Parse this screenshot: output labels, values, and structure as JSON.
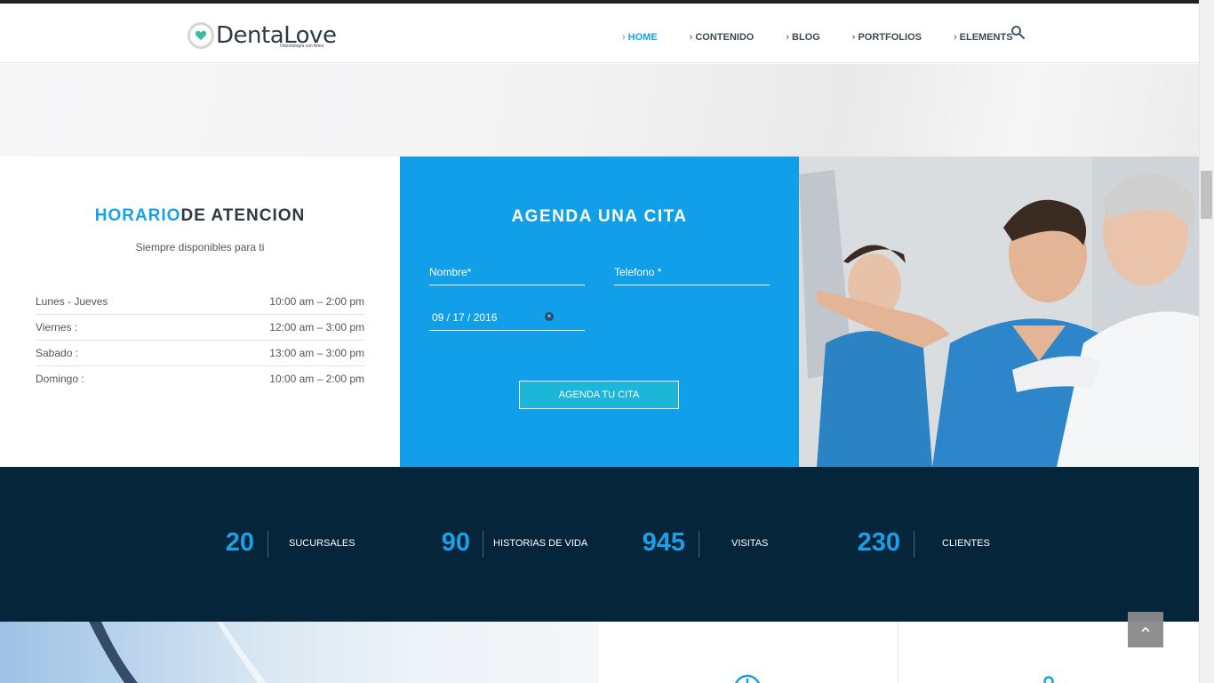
{
  "brand": {
    "name": "DentaLove",
    "tagline": "Odontología con Amor"
  },
  "nav": {
    "items": [
      {
        "label": "HOME",
        "active": true
      },
      {
        "label": "CONTENIDO",
        "active": false
      },
      {
        "label": "BLOG",
        "active": false
      },
      {
        "label": "PORTFOLIOS",
        "active": false
      },
      {
        "label": "ELEMENTS",
        "active": false
      }
    ],
    "search_icon": "search-icon"
  },
  "schedule": {
    "title_highlight": "HORARIO",
    "title_rest": "DE ATENCION",
    "subtitle": "Siempre disponibles para ti",
    "rows": [
      {
        "day": "Lunes - Jueves",
        "hours": "10:00 am – 2:00 pm"
      },
      {
        "day": "Viernes :",
        "hours": "12:00 am – 3:00 pm"
      },
      {
        "day": "Sabado :",
        "hours": "13:00 am – 3:00 pm"
      },
      {
        "day": "Domingo :",
        "hours": "10:00 am – 2:00 pm"
      }
    ]
  },
  "appointment": {
    "title": "AGENDA UNA CITA",
    "name_placeholder": "Nombre*",
    "phone_placeholder": "Telefono *",
    "date_value": "09 / 17 / 2016",
    "submit_label": "AGENDA TU CITA"
  },
  "stats": [
    {
      "value": "20",
      "label": "SUCURSALES"
    },
    {
      "value": "90",
      "label": "HISTORIAS DE VIDA"
    },
    {
      "value": "945",
      "label": "VISITAS"
    },
    {
      "value": "230",
      "label": "CLIENTES"
    }
  ],
  "colors": {
    "accent": "#1aa0e8",
    "form_bg": "#109fe8",
    "stats_bg": "#05263a",
    "button": "#1cb6d8"
  }
}
